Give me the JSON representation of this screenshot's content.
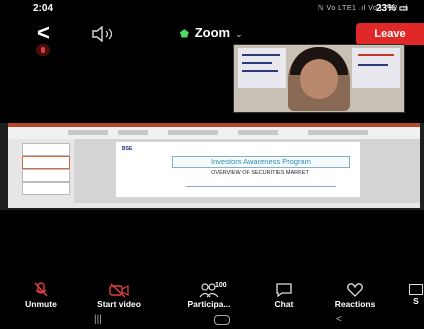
{
  "status_bar": {
    "time": "2:04",
    "signal": "ℕ Vo LTE1 .ıl Vo LTE2 .ıl",
    "battery": "23%"
  },
  "header": {
    "app_title": "Zoom",
    "leave_label": "Leave"
  },
  "share": {
    "slide_title": "Investors Awareness Program",
    "slide_subtitle": "OVERVIEW OF SECURITIES MARKET",
    "logo_text": "BSE"
  },
  "toolbar": {
    "unmute_label": "Unmute",
    "start_video_label": "Start video",
    "participants_label": "Participa...",
    "participants_count": "100",
    "chat_label": "Chat",
    "reactions_label": "Reactions",
    "share_label": "S"
  },
  "icons": [
    "back-arrow-icon",
    "speaker-icon",
    "shield-icon",
    "chevron-down-icon",
    "microphone-muted-icon",
    "video-off-icon",
    "participants-icon",
    "chat-icon",
    "heart-icon",
    "recent-apps-icon",
    "home-icon",
    "nav-back-icon"
  ],
  "colors": {
    "leave": "#e02828",
    "shield": "#4cd964",
    "ribbon": "#b7472a",
    "slide_title": "#2d8fb0"
  }
}
